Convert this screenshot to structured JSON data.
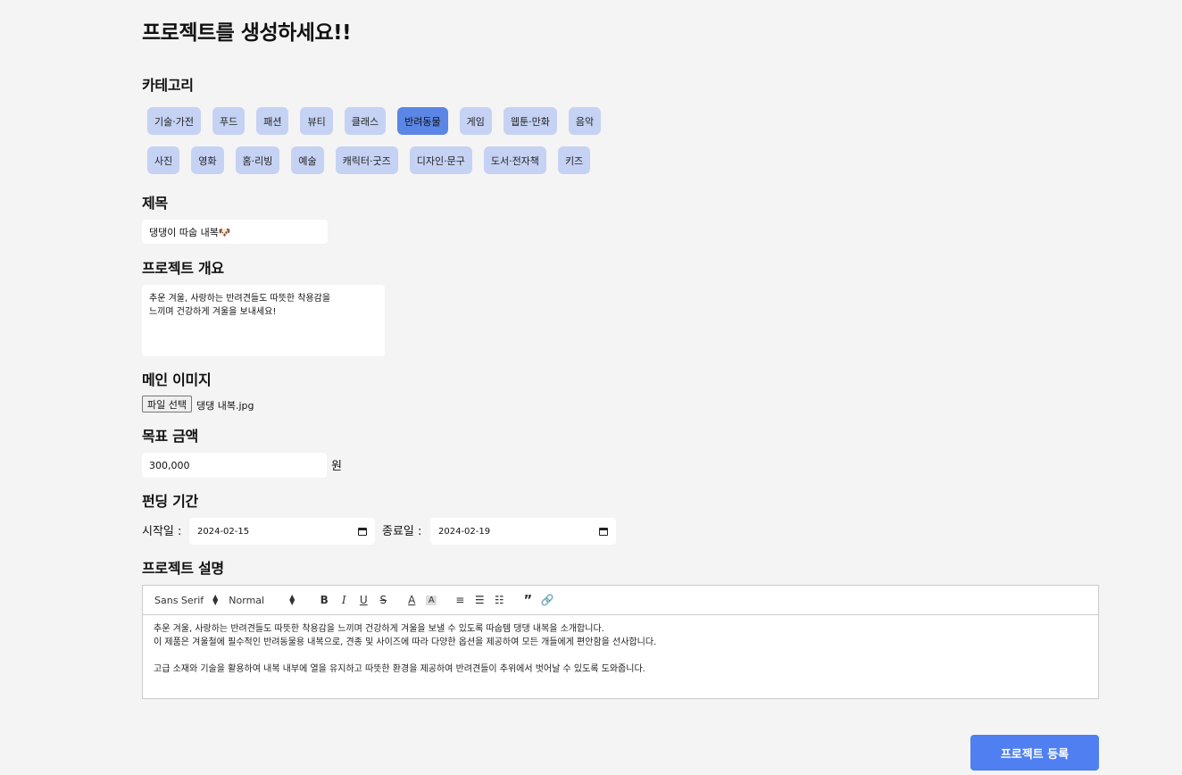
{
  "page_title": "프로젝트를 생성하세요!!",
  "category": {
    "label": "카테고리",
    "row1": [
      {
        "name": "기술·가전",
        "active": false
      },
      {
        "name": "푸드",
        "active": false
      },
      {
        "name": "패션",
        "active": false
      },
      {
        "name": "뷰티",
        "active": false
      },
      {
        "name": "클래스",
        "active": false
      },
      {
        "name": "반려동물",
        "active": true
      },
      {
        "name": "게임",
        "active": false
      },
      {
        "name": "웹툰·만화",
        "active": false
      },
      {
        "name": "음악",
        "active": false
      }
    ],
    "row2": [
      {
        "name": "사진",
        "active": false
      },
      {
        "name": "영화",
        "active": false
      },
      {
        "name": "홈·리빙",
        "active": false
      },
      {
        "name": "예술",
        "active": false
      },
      {
        "name": "캐릭터·굿즈",
        "active": false
      },
      {
        "name": "디자인·문구",
        "active": false
      },
      {
        "name": "도서·전자책",
        "active": false
      },
      {
        "name": "키즈",
        "active": false
      }
    ]
  },
  "title_field": {
    "label": "제목",
    "value": "댕댕이 따숩 내복🐶"
  },
  "summary": {
    "label": "프로젝트 개요",
    "line1": "추운 겨울, 사랑하는 반려견들도 따뜻한 착용감을",
    "line2": "느끼며 건강하게 겨울을 보내세요!"
  },
  "main_image": {
    "label": "메인 이미지",
    "button": "파일 선택",
    "file_name": "댕댕 내복.jpg"
  },
  "goal": {
    "label": "목표 금액",
    "value": "300,000",
    "unit": "원"
  },
  "period": {
    "label": "펀딩 기간",
    "start_label": "시작일 :",
    "start_value": "2024-02-15",
    "end_label": "종료일 :",
    "end_value": "2024-02-19"
  },
  "description": {
    "label": "프로젝트 설명",
    "font": "Sans Serif",
    "size": "Normal",
    "line1": "추운 겨울, 사랑하는 반려견들도 따뜻한 착용감을 느끼며 건강하게 겨울을 보낼 수 있도록 따숩템 댕댕 내복을 소개합니다.",
    "line2": "이 제품은 겨울철에 필수적인 반려동물용 내복으로, 견종 및 사이즈에 따라 다양한 옵션을 제공하여 모든 개들에게 편안함을 선사합니다.",
    "line3": "고급 소재와 기술을 활용하여 내복 내부에 열을 유지하고 따뜻한 환경을 제공하여 반려견들이 추위에서 벗어날 수 있도록 도와줍니다."
  },
  "submit_label": "프로젝트 등록",
  "colors": {
    "accent": "#4f7ff0",
    "chip": "#c5d2f3",
    "chip_active": "#5b86e5"
  }
}
